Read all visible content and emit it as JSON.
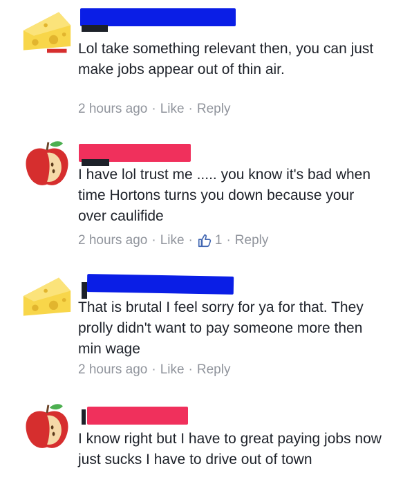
{
  "comments": [
    {
      "avatar": "cheese-icon",
      "name_redaction_color": "#0a1ee6",
      "text": "Lol take something relevant then, you can just make jobs appear out of thin air.",
      "time": "2 hours ago",
      "like_label": "Like",
      "reply_label": "Reply"
    },
    {
      "avatar": "apple-icon",
      "name_redaction_color": "#f0305c",
      "text": "I have lol trust me ..... you know it's bad when time Hortons turns you down because your over caulifide",
      "time": "2 hours ago",
      "like_label": "Like",
      "like_count": "1",
      "reply_label": "Reply"
    },
    {
      "avatar": "cheese-icon",
      "name_redaction_color": "#0a1ee6",
      "text": "That is brutal I feel sorry for ya for that. They prolly didn't want to pay someone more then min wage",
      "time": "2 hours ago",
      "like_label": "Like",
      "reply_label": "Reply"
    },
    {
      "avatar": "apple-icon",
      "name_redaction_color": "#f0305c",
      "text": "I know right but I have to great paying jobs now just sucks I have to drive out of town"
    }
  ],
  "colors": {
    "meta_text": "#90949c",
    "body_text": "#1d2129",
    "separator": "#e4e5e9"
  }
}
